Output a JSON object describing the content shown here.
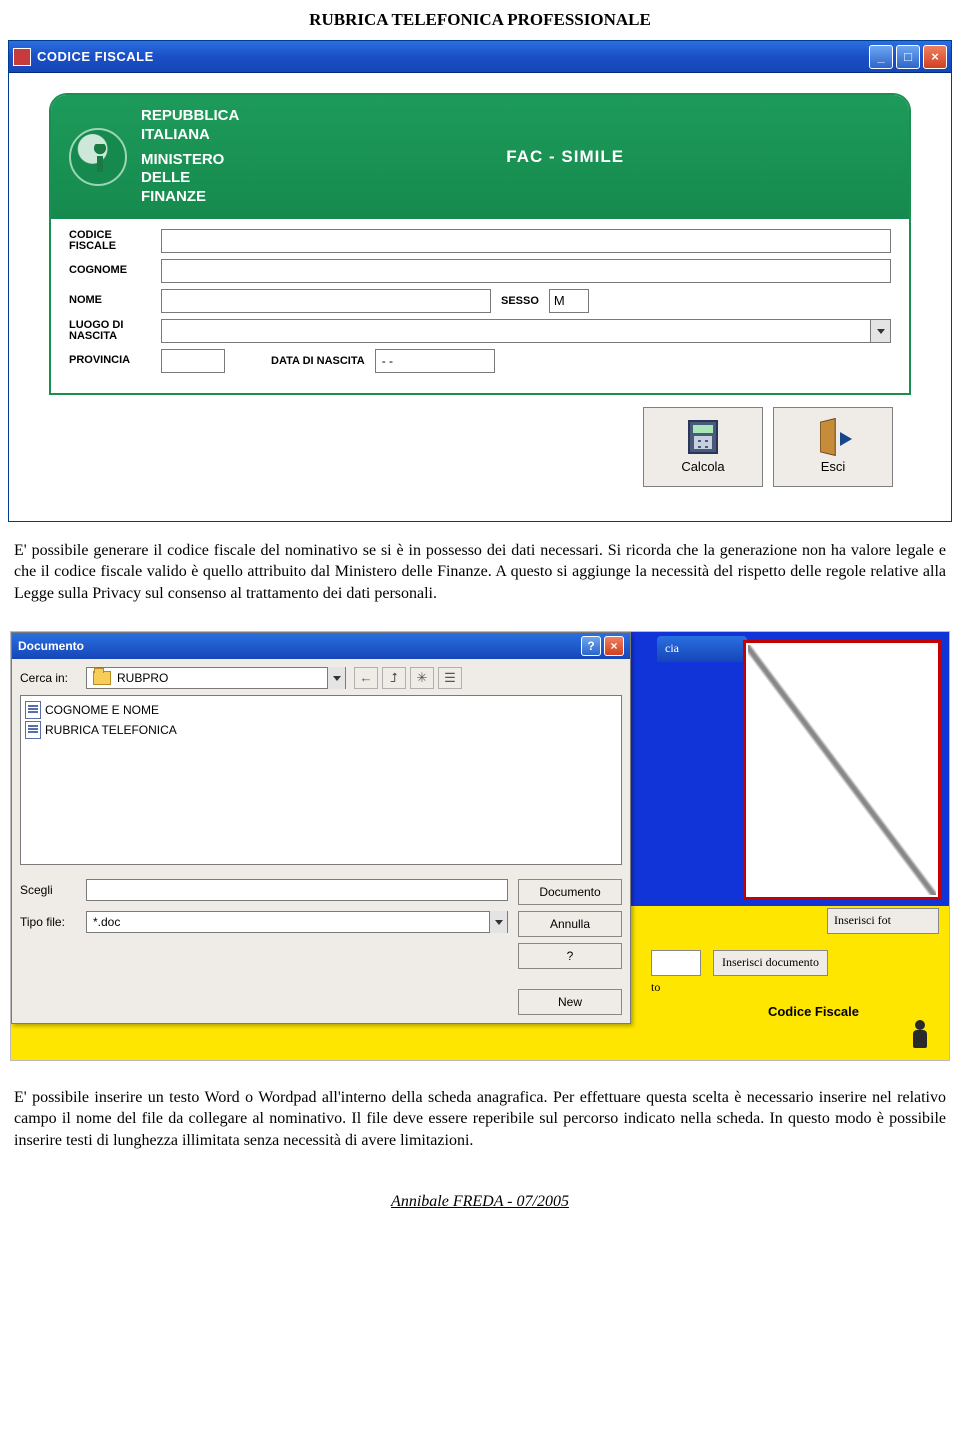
{
  "header": {
    "title": "RUBRICA TELEFONICA PROFESSIONALE"
  },
  "win1": {
    "title": "CODICE FISCALE",
    "card": {
      "rep1": "REPUBBLICA",
      "rep2": "ITALIANA",
      "min1": "MINISTERO",
      "min2": "DELLE",
      "min3": "FINANZE",
      "fac": "FAC - SIMILE",
      "labels": {
        "cf1": "CODICE",
        "cf2": "FISCALE",
        "cognome": "COGNOME",
        "nome": "NOME",
        "sesso": "SESSO",
        "sesso_val": "M",
        "luogo1": "LUOGO DI",
        "luogo2": "NASCITA",
        "provincia": "PROVINCIA",
        "dob": "DATA DI NASCITA",
        "dob_val": "- -"
      }
    },
    "btn_calcola": "Calcola",
    "btn_esci": "Esci"
  },
  "para1": "E' possibile generare il codice fiscale del nominativo se si è in possesso dei dati necessari. Si ricorda che la generazione non ha valore legale e che il codice fiscale valido è quello attribuito dal Ministero delle Finanze. A questo si aggiunge la necessità del rispetto delle regole relative alla Legge sulla Privacy sul consenso al trattamento dei dati personali.",
  "shot2": {
    "tab_cia": "cia",
    "ins_foto": "Inserisci fot",
    "btn_ins_doc": "Inserisci documento",
    "tag_to": "to",
    "cf_label": "Codice Fiscale",
    "dlg": {
      "title": "Documento",
      "cerca_in": "Cerca in:",
      "folder": "RUBPRO",
      "file1": "COGNOME E NOME",
      "file2": "RUBRICA TELEFONICA",
      "scegli": "Scegli",
      "tipo_file": "Tipo file:",
      "tipo_val": "*.doc",
      "btn_doc": "Documento",
      "btn_annulla": "Annulla",
      "btn_help": "?",
      "btn_new": "New"
    }
  },
  "para2": "E' possibile inserire un testo Word o Wordpad all'interno della scheda anagrafica. Per effettuare questa scelta è necessario inserire nel relativo campo il nome del file da collegare al nominativo. Il file deve essere reperibile sul percorso indicato nella scheda. In questo modo è possibile inserire testi di lunghezza illimitata senza necessità di avere limitazioni.",
  "footer": "Annibale FREDA - 07/2005"
}
